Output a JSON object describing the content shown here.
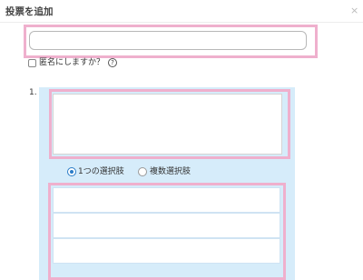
{
  "dialog": {
    "title": "投票を追加",
    "close_symbol": "×"
  },
  "poll_title": {
    "value": "",
    "placeholder": ""
  },
  "anonymous": {
    "label": "匿名にしますか？",
    "checked": false,
    "help_symbol": "?"
  },
  "question": {
    "number": "1.",
    "text": "",
    "mode": {
      "single_label": "1つの選択肢",
      "multiple_label": "複数選択肢",
      "selected": "single"
    },
    "options": [
      {
        "value": ""
      },
      {
        "value": ""
      },
      {
        "value": ""
      }
    ]
  },
  "colors": {
    "highlight": "#efb0cd",
    "panel": "#d6ecfa",
    "radio_selected": "#2a7cc7"
  }
}
